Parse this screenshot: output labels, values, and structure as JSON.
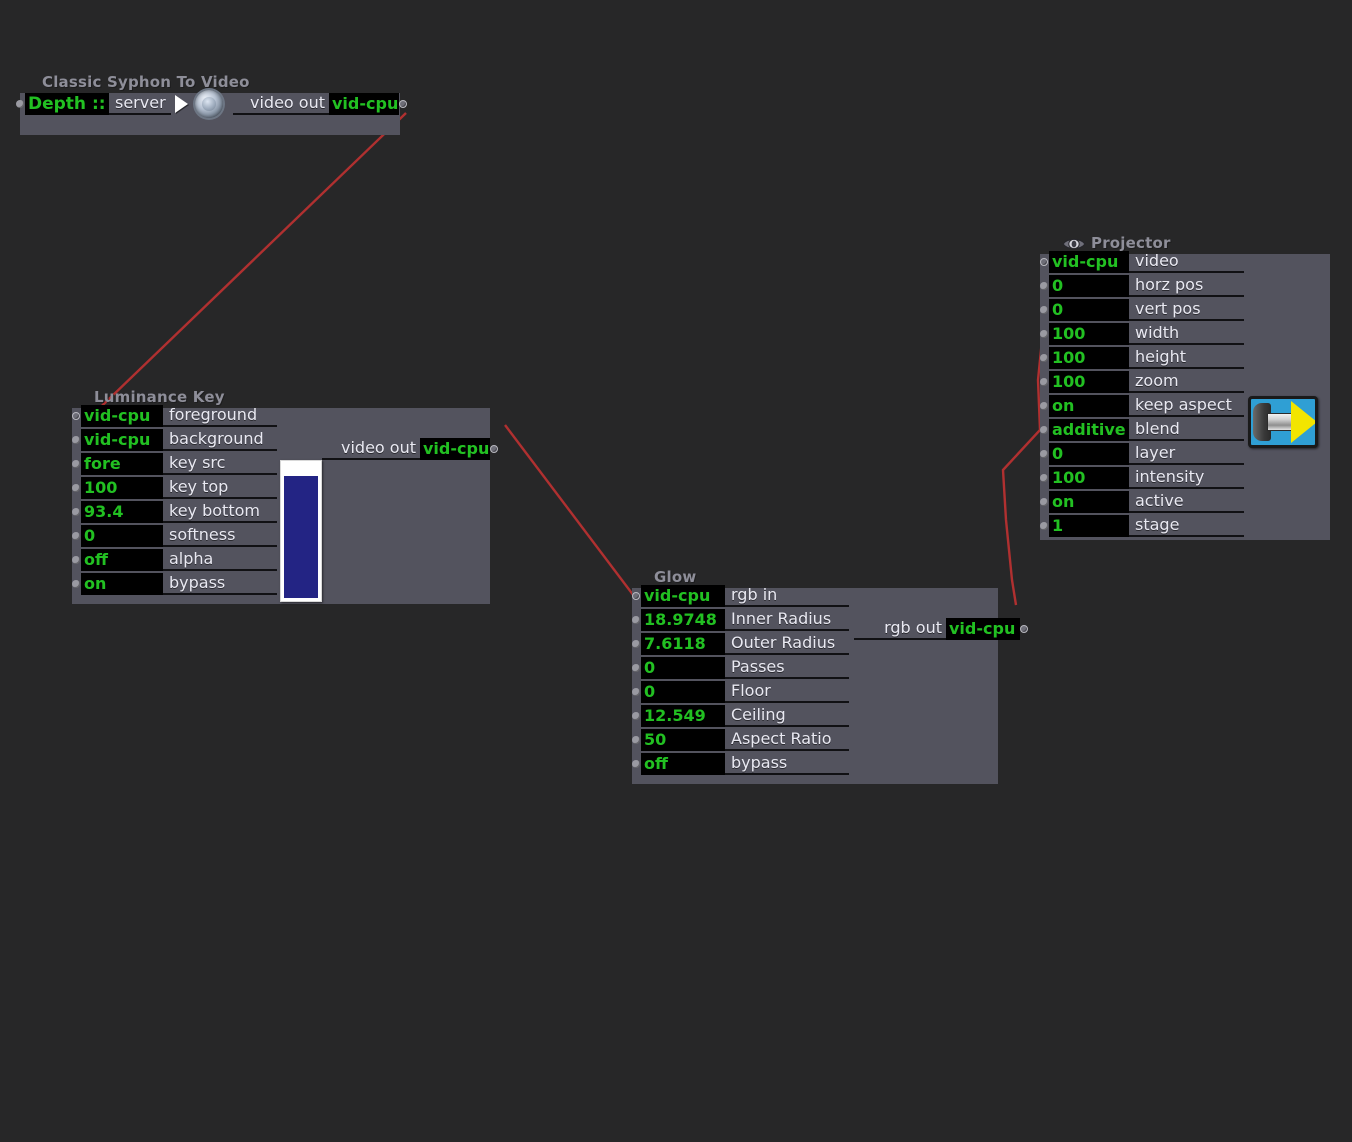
{
  "theme": {
    "canvas_bg": "#272728",
    "node_panel": "#53535e",
    "value_green": "#22c022",
    "label_text": "#e9e9f2",
    "title_text": "#8e8e99",
    "wire_red": "#b03030",
    "slider_fill": "#232484"
  },
  "nodes": {
    "syphon": {
      "title": "Classic Syphon To Video",
      "server_value": "Depth ::",
      "server_label": "server",
      "output_label": "video out",
      "output_value": "vid-cpu",
      "icons": {
        "play": "play-triangle-icon",
        "sphere": "syphon-sphere-icon"
      }
    },
    "luminance_key": {
      "title": "Luminance Key",
      "output_label": "video out",
      "output_value": "vid-cpu",
      "params": [
        {
          "value": "vid-cpu",
          "label": "foreground"
        },
        {
          "value": "vid-cpu",
          "label": "background"
        },
        {
          "value": "fore",
          "label": "key src"
        },
        {
          "value": "100",
          "label": "key top"
        },
        {
          "value": "93.4",
          "label": "key bottom"
        },
        {
          "value": "0",
          "label": "softness"
        },
        {
          "value": "off",
          "label": "alpha"
        },
        {
          "value": "on",
          "label": "bypass"
        }
      ]
    },
    "glow": {
      "title": "Glow",
      "output_label": "rgb out",
      "output_value": "vid-cpu",
      "params": [
        {
          "value": "vid-cpu",
          "label": "rgb in"
        },
        {
          "value": "18.9748",
          "label": "Inner Radius"
        },
        {
          "value": "7.6118",
          "label": "Outer Radius"
        },
        {
          "value": "0",
          "label": "Passes"
        },
        {
          "value": "0",
          "label": "Floor"
        },
        {
          "value": "12.549",
          "label": "Ceiling"
        },
        {
          "value": "50",
          "label": "Aspect Ratio"
        },
        {
          "value": "off",
          "label": "bypass"
        }
      ]
    },
    "projector": {
      "title": "Projector",
      "icon": "eye-icon",
      "params": [
        {
          "value": "vid-cpu",
          "label": "video"
        },
        {
          "value": "0",
          "label": "horz pos"
        },
        {
          "value": "0",
          "label": "vert pos"
        },
        {
          "value": "100",
          "label": "width"
        },
        {
          "value": "100",
          "label": "height"
        },
        {
          "value": "100",
          "label": "zoom"
        },
        {
          "value": "on",
          "label": "keep aspect"
        },
        {
          "value": "additive",
          "label": "blend"
        },
        {
          "value": "0",
          "label": "layer"
        },
        {
          "value": "100",
          "label": "intensity"
        },
        {
          "value": "on",
          "label": "active"
        },
        {
          "value": "1",
          "label": "stage"
        }
      ]
    }
  },
  "connections": [
    {
      "from": "syphon.video-out",
      "to": "luminance-key.foreground"
    },
    {
      "from": "luminance-key.video-out",
      "to": "glow.rgb-in"
    },
    {
      "from": "glow.rgb-out",
      "to": "projector.video"
    }
  ]
}
